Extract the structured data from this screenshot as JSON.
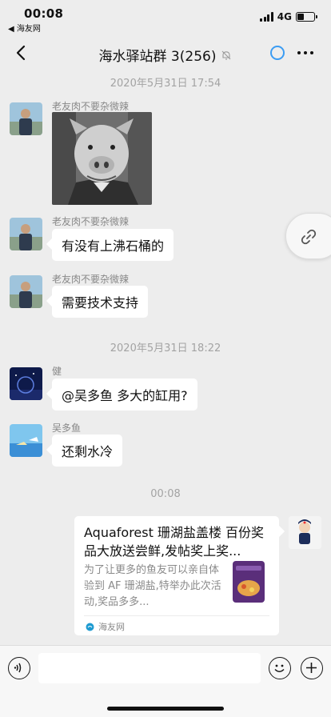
{
  "status_bar": {
    "time": "00:08",
    "back_app": "◀ 海友网",
    "network": "4G"
  },
  "nav": {
    "title": "海水驿站群 3(256)"
  },
  "messages": {
    "ts1": "2020年5月31日 17:54",
    "m1_sender": "老友肉不要杂微辣",
    "m2_sender": "老友肉不要杂微辣",
    "m2_text": "有没有上沸石桶的",
    "m3_sender": "老友肉不要杂微辣",
    "m3_text": "需要技术支持",
    "ts2": "2020年5月31日 18:22",
    "m4_sender": "健",
    "m4_text": "@吴多鱼 多大的缸用?",
    "m5_sender": "吴多鱼",
    "m5_text": "还剩水冷",
    "ts3": "00:08"
  },
  "card": {
    "title": "Aquaforest 珊湖盐盖楼 百份奖品大放送尝鲜,发帖奖上奖...",
    "desc": "为了让更多的鱼友可以亲自体验到 AF 珊湖盐,特举办此次活动,奖品多多...",
    "source": "海友网"
  },
  "colors": {
    "background": "#ededed",
    "accent_blue": "#3b9cf3",
    "bubble": "#ffffff"
  },
  "icons": [
    "back-arrow-icon",
    "mute-bell-icon",
    "mini-program-icon",
    "more-icon",
    "link-icon",
    "voice-icon",
    "emoji-icon",
    "plus-icon"
  ]
}
